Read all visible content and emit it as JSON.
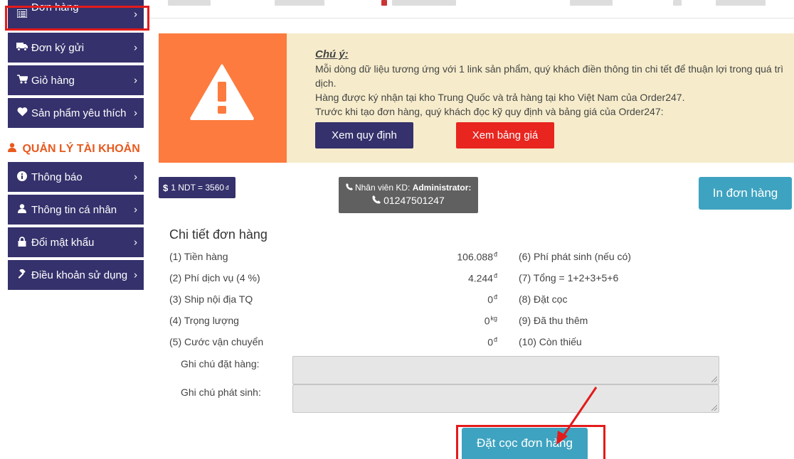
{
  "sidebar": {
    "items": [
      {
        "label": "Đơn hàng",
        "icon": "list-icon"
      },
      {
        "label": "Đơn ký gửi",
        "icon": "truck-icon"
      },
      {
        "label": "Giỏ hàng",
        "icon": "cart-icon"
      },
      {
        "label": "Sản phẩm yêu thích",
        "icon": "heart-icon"
      }
    ],
    "account_title": "QUẢN LÝ TÀI KHOẢN",
    "account_items": [
      {
        "label": "Thông báo",
        "icon": "info-icon"
      },
      {
        "label": "Thông tin cá nhân",
        "icon": "user-icon"
      },
      {
        "label": "Đổi mật khẩu",
        "icon": "lock-icon"
      },
      {
        "label": "Điều khoản sử dụng",
        "icon": "gavel-icon"
      }
    ]
  },
  "notice": {
    "caution": "Chú ý:",
    "lines": [
      "Mỗi dòng dữ liệu tương ứng với 1 link sản phẩm, quý khách điền thông tin chi tết để thuận lợi trong quá trì",
      "dịch.",
      "Hàng được ký nhận tại kho Trung Quốc và trả hàng tại kho Việt Nam của Order247.",
      "Trước khi tạo đơn hàng, quý khách đọc kỹ quy định và bảng giá của Order247:"
    ],
    "btn_rules": "Xem quy định",
    "btn_price": "Xem bảng giá"
  },
  "info": {
    "rate_symbol": "$",
    "rate_text": "1 NDT = 3560",
    "rate_unit": "đ",
    "staff_label": "Nhân viên KD:",
    "staff_name": "Administrator:",
    "staff_phone": "01247501247",
    "print_label": "In đơn hàng"
  },
  "detail": {
    "title": "Chi tiết đơn hàng",
    "left": [
      {
        "label": "(1) Tiền hàng",
        "value": "106.088",
        "unit": "đ"
      },
      {
        "label": "(2) Phí dịch vụ (4 %)",
        "value": "4.244",
        "unit": "đ"
      },
      {
        "label": "(3) Ship nội địa TQ",
        "value": "0",
        "unit": "đ"
      },
      {
        "label": "(4) Trọng lượng",
        "value": "0",
        "unit": "kg"
      },
      {
        "label": "(5) Cước vận chuyển",
        "value": "0",
        "unit": "đ"
      }
    ],
    "right": [
      "(6) Phí phát sinh (nếu có)",
      "(7) Tổng = 1+2+3+5+6",
      "(8) Đặt cọc",
      "(9) Đã thu thêm",
      "(10) Còn thiếu"
    ],
    "note_order_label": "Ghi chú đặt hàng:",
    "note_extra_label": "Ghi chú phát sinh:",
    "deposit_label": "Đặt cọc đơn hàng"
  },
  "colors": {
    "nav": "#35316c",
    "accent_orange": "#fd7b3f",
    "notice_bg": "#f6eccb",
    "teal": "#3ea3c0",
    "red": "#e8251f",
    "highlight": "#e31b1b"
  }
}
